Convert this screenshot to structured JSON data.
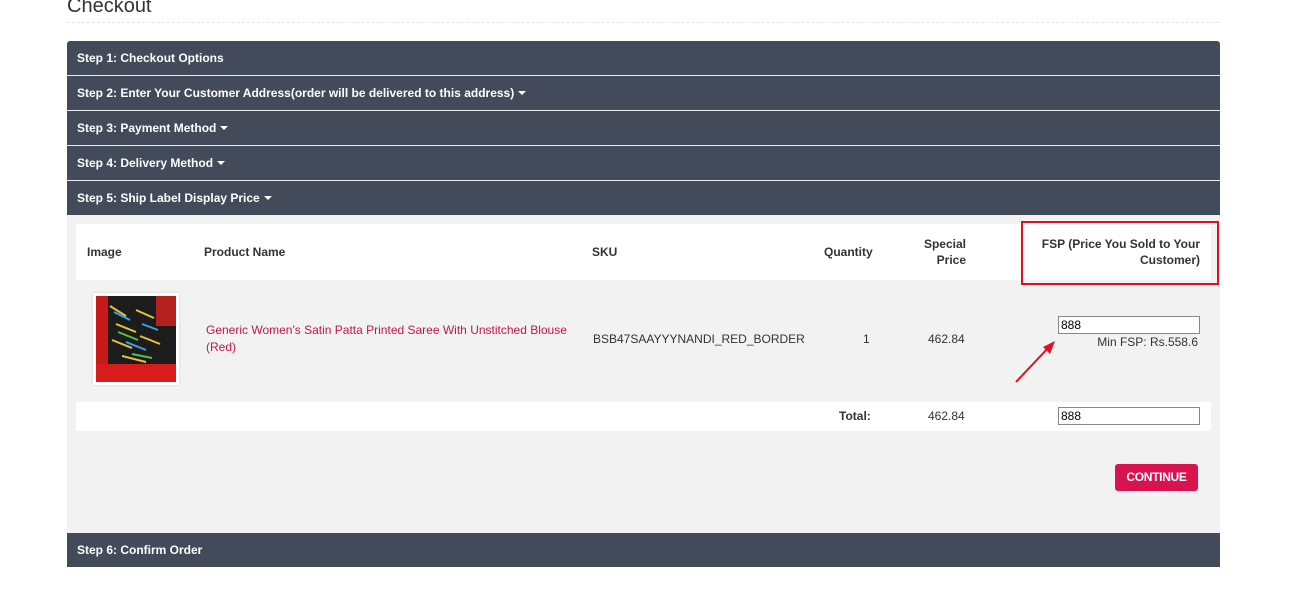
{
  "page": {
    "title": "Checkout"
  },
  "steps": [
    {
      "label": "Step 1: Checkout Options",
      "caret": false
    },
    {
      "label": "Step 2: Enter Your Customer Address(order will be delivered to this address)",
      "caret": true
    },
    {
      "label": "Step 3: Payment Method",
      "caret": true
    },
    {
      "label": "Step 4: Delivery Method",
      "caret": true
    },
    {
      "label": "Step 5: Ship Label Display Price",
      "caret": true
    },
    {
      "label": "Step 6: Confirm Order",
      "caret": false
    }
  ],
  "table": {
    "headers": {
      "image": "Image",
      "product_name": "Product Name",
      "sku": "SKU",
      "quantity": "Quantity",
      "special_price_line1": "Special",
      "special_price_line2": "Price",
      "fsp_line1": "FSP (Price You Sold to Your",
      "fsp_line2": "Customer)"
    },
    "rows": [
      {
        "product_name_line1": "Generic Women's Satin Patta Printed Saree With Unstitched Blouse",
        "product_name_line2": "(Red)",
        "sku": "BSB47SAAYYYNANDI_RED_BORDER",
        "quantity": "1",
        "special_price": "462.84",
        "fsp_value": "888",
        "min_fsp": "Min FSP: Rs.558.6"
      }
    ],
    "total": {
      "label": "Total:",
      "special_price": "462.84",
      "fsp_value": "888"
    }
  },
  "buttons": {
    "continue": "CONTINUE"
  },
  "colors": {
    "header_bg": "#434a59",
    "accent": "#d9134f",
    "link": "#c7144c",
    "highlight": "#e0101e"
  },
  "icons": {
    "caret": "caret-down-icon",
    "annotation": "red-arrow-icon"
  }
}
